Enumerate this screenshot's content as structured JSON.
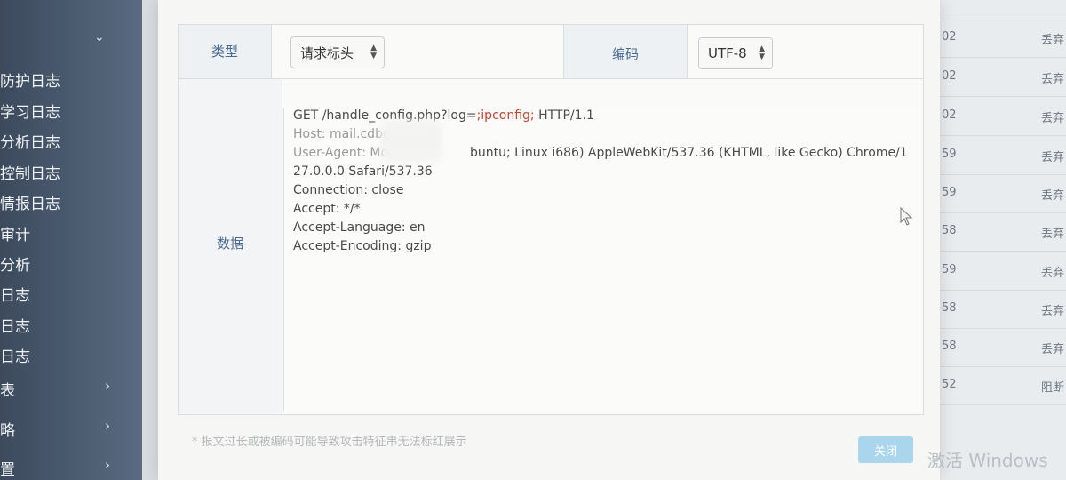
{
  "sidebar": {
    "items": [
      {
        "label": "防护日志"
      },
      {
        "label": "学习日志"
      },
      {
        "label": "分析日志"
      },
      {
        "label": "控制日志"
      },
      {
        "label": "情报日志"
      },
      {
        "label": "审计"
      },
      {
        "label": "分析"
      },
      {
        "label": "日志"
      },
      {
        "label": "日志"
      },
      {
        "label": "日志"
      },
      {
        "label": "表"
      },
      {
        "label": "略"
      },
      {
        "label": "置"
      }
    ]
  },
  "dialog": {
    "type_label": "类型",
    "type_value": "请求标头",
    "encoding_label": "编码",
    "encoding_value": "UTF-8",
    "data_label": "数据",
    "data_lines": [
      {
        "text": "GET /handle_config.php?log=",
        "hl": ";ipconfig;",
        "rest": " HTTP/1.1"
      },
      {
        "text": "Host: mail.cdbc"
      },
      {
        "text": "User-Agent: Mo",
        "rest": "buntu; Linux i686) AppleWebKit/537.36 (KHTML, like Gecko) Chrome/1"
      },
      {
        "text": "27.0.0.0 Safari/537.36"
      },
      {
        "text": "Connection: close"
      },
      {
        "text": "Accept: */*"
      },
      {
        "text": "Accept-Language: en"
      },
      {
        "text": "Accept-Encoding: gzip"
      }
    ],
    "note": "* 报文过长或被编码可能导致攻击特征串无法标红展示",
    "close_label": "关闭"
  },
  "background_list": {
    "rows": [
      {
        "num": "02",
        "action": "丢弃"
      },
      {
        "num": "02",
        "action": "丢弃"
      },
      {
        "num": "02",
        "action": "丢弃"
      },
      {
        "num": "59",
        "action": "丢弃"
      },
      {
        "num": "59",
        "action": "丢弃"
      },
      {
        "num": "58",
        "action": "丢弃"
      },
      {
        "num": "59",
        "action": "丢弃"
      },
      {
        "num": "58",
        "action": "丢弃"
      },
      {
        "num": "58",
        "action": "丢弃"
      },
      {
        "num": "52",
        "action": "阻断"
      }
    ]
  },
  "watermark": "激活 Windows",
  "colors": {
    "label_text": "#4a6a92",
    "highlight": "#c8432e",
    "close_button": "#a9d6ec",
    "sidebar": "#4d5d72"
  },
  "icons": [
    "chevron-down-icon",
    "chevron-right-icon",
    "select-arrows-icon",
    "mouse-cursor-icon"
  ]
}
